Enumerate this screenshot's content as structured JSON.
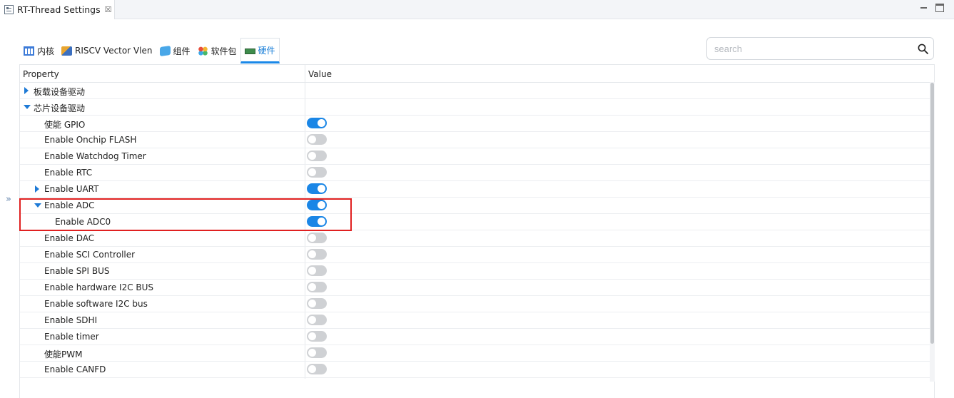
{
  "editor_tab": {
    "title": "RT-Thread Settings",
    "close_glyph": "☒"
  },
  "view_tabs": [
    {
      "label": "内核",
      "icon": "table-icon"
    },
    {
      "label": "RISCV Vector Vlen",
      "icon": "chip-icon"
    },
    {
      "label": "组件",
      "icon": "cube-icon"
    },
    {
      "label": "软件包",
      "icon": "package-icon"
    },
    {
      "label": "硬件",
      "icon": "board-icon",
      "active": true
    }
  ],
  "search": {
    "placeholder": "search",
    "value": ""
  },
  "side_toggle": "»",
  "table": {
    "headers": {
      "property": "Property",
      "value": "Value"
    },
    "rows": [
      {
        "label": "板载设备驱动",
        "level": 0,
        "expander": "collapsed"
      },
      {
        "label": "芯片设备驱动",
        "level": 0,
        "expander": "expanded"
      },
      {
        "label": "使能 GPIO",
        "level": 1,
        "toggle": true
      },
      {
        "label": "Enable Onchip FLASH",
        "level": 1,
        "toggle": false
      },
      {
        "label": "Enable Watchdog Timer",
        "level": 1,
        "toggle": false
      },
      {
        "label": "Enable RTC",
        "level": 1,
        "toggle": false
      },
      {
        "label": "Enable UART",
        "level": 1,
        "expander": "collapsed",
        "toggle": true
      },
      {
        "label": "Enable ADC",
        "level": 1,
        "expander": "expanded",
        "toggle": true
      },
      {
        "label": "Enable ADC0",
        "level": 2,
        "toggle": true
      },
      {
        "label": "Enable DAC",
        "level": 1,
        "toggle": false
      },
      {
        "label": "Enable SCI Controller",
        "level": 1,
        "toggle": false
      },
      {
        "label": "Enable SPI BUS",
        "level": 1,
        "toggle": false
      },
      {
        "label": "Enable hardware I2C BUS",
        "level": 1,
        "toggle": false
      },
      {
        "label": "Enable software I2C bus",
        "level": 1,
        "toggle": false
      },
      {
        "label": "Enable SDHI",
        "level": 1,
        "toggle": false
      },
      {
        "label": "Enable timer",
        "level": 1,
        "toggle": false
      },
      {
        "label": "使能PWM",
        "level": 1,
        "toggle": false
      },
      {
        "label": "Enable CANFD",
        "level": 1,
        "toggle": false
      }
    ]
  },
  "colors": {
    "accent": "#1a86e6",
    "toggle_off": "#cfd1d4",
    "highlight": "#e02020"
  }
}
